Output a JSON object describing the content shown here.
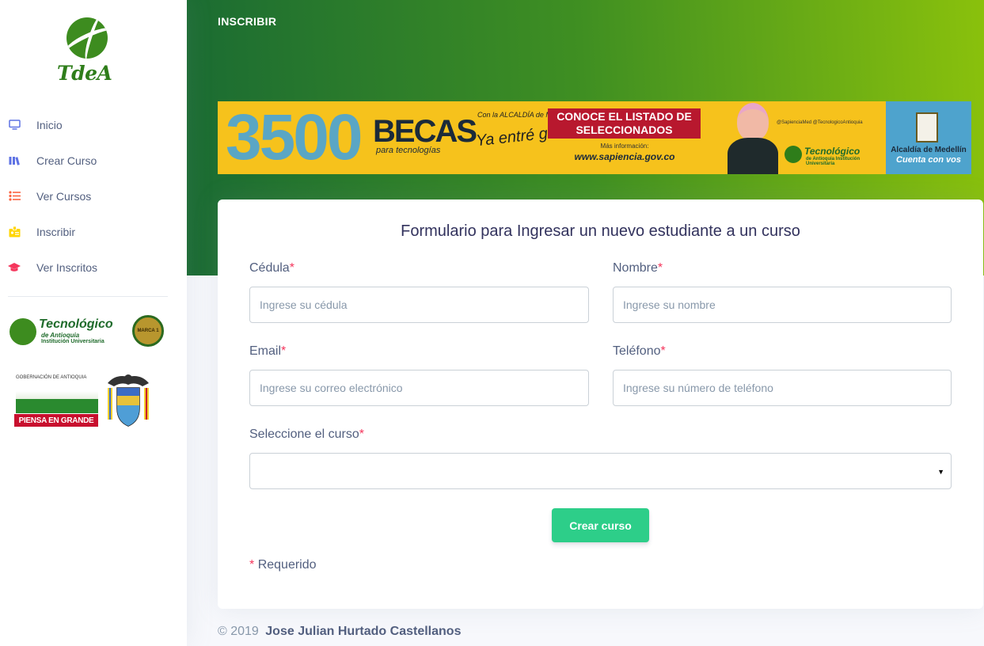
{
  "brand": {
    "logo_text": "TdeA"
  },
  "sidebar": {
    "items": [
      {
        "label": "Inicio",
        "icon": "monitor-icon",
        "color": "#5e72e4"
      },
      {
        "label": "Crear Curso",
        "icon": "books-icon",
        "color": "#5e72e4"
      },
      {
        "label": "Ver Cursos",
        "icon": "list-icon",
        "color": "#fb6340"
      },
      {
        "label": "Inscribir",
        "icon": "badge-icon",
        "color": "#ffd600"
      },
      {
        "label": "Ver Inscritos",
        "icon": "graduation-cap-icon",
        "color": "#f5365c"
      }
    ],
    "logo_tec": {
      "title": "Tecnológico",
      "sub": "de Antioquia",
      "sub2": "Institución Universitaria",
      "seal": "MARCA 1"
    },
    "logo_gob": {
      "title": "GOBERNACIÓN DE ANTIOQUIA",
      "slogan": "PIENSA EN GRANDE"
    }
  },
  "header": {
    "title": "INSCRIBIR"
  },
  "banner": {
    "number": "3500",
    "becas": "BECAS",
    "para": "para tecnologías",
    "ya_small": "Con la ALCALDÍA de MEDELLÍN",
    "ya_big": "Ya entré ganando",
    "cta": "CONOCE EL LISTADO DE SELECCIONADOS",
    "info": "Más información:",
    "url": "www.sapiencia.gov.co",
    "social": "@SapienciaMed  @TecnologicoAntioquia",
    "tec_title": "Tecnológico",
    "tec_sub": "de Antioquia Institución Universitaria",
    "alc_title": "Alcaldía de Medellín",
    "alc_slogan": "Cuenta con vos"
  },
  "form": {
    "title": "Formulario para Ingresar un nuevo estudiante a un curso",
    "cedula": {
      "label": "Cédula",
      "placeholder": "Ingrese su cédula"
    },
    "nombre": {
      "label": "Nombre",
      "placeholder": "Ingrese su nombre"
    },
    "email": {
      "label": "Email",
      "placeholder": "Ingrese su correo electrónico"
    },
    "telefono": {
      "label": "Teléfono",
      "placeholder": "Ingrese su número de teléfono"
    },
    "curso": {
      "label": "Seleccione el curso",
      "value": ""
    },
    "required_mark": "*",
    "submit_label": "Crear curso",
    "required_note": "Requerido"
  },
  "footer": {
    "copyright": "© 2019",
    "author": "Jose Julian Hurtado Castellanos"
  },
  "colors": {
    "primary": "#5e72e4",
    "success": "#2dce89",
    "header_start": "#1a6b33",
    "header_end": "#8ac10c",
    "required": "#f5365c"
  }
}
